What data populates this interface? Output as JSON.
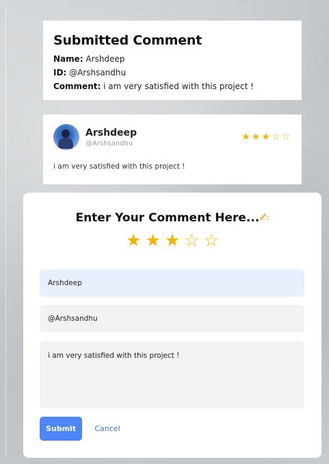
{
  "submitted": {
    "title": "Submitted Comment",
    "name_label": "Name:",
    "name_value": "Arshdeep",
    "id_label": "ID:",
    "id_value": "@Arshsandhu",
    "comment_label": "Comment:",
    "comment_value": "i am very satisfied with this project !"
  },
  "comment_card": {
    "name": "Arshdeep",
    "handle": "@Arshsandhu",
    "rating": 3,
    "max_rating": 5,
    "text": "i am very satisfied with this project !",
    "avatar_icon": "user-avatar-icon"
  },
  "form": {
    "title": "Enter Your Comment Here...",
    "title_icon": "writing-hand-icon",
    "rating": 3,
    "max_rating": 5,
    "name_value": "Arshdeep",
    "id_value": "@Arshsandhu",
    "comment_value": "i am very satisfied with this project !",
    "submit_label": "Submit",
    "cancel_label": "Cancel"
  },
  "colors": {
    "star": "#f5b301",
    "submit_bg": "#4f86f7",
    "cancel_text": "#3d6fe0",
    "name_field_bg": "#e8f0fe",
    "field_bg": "#f2f2f2"
  }
}
